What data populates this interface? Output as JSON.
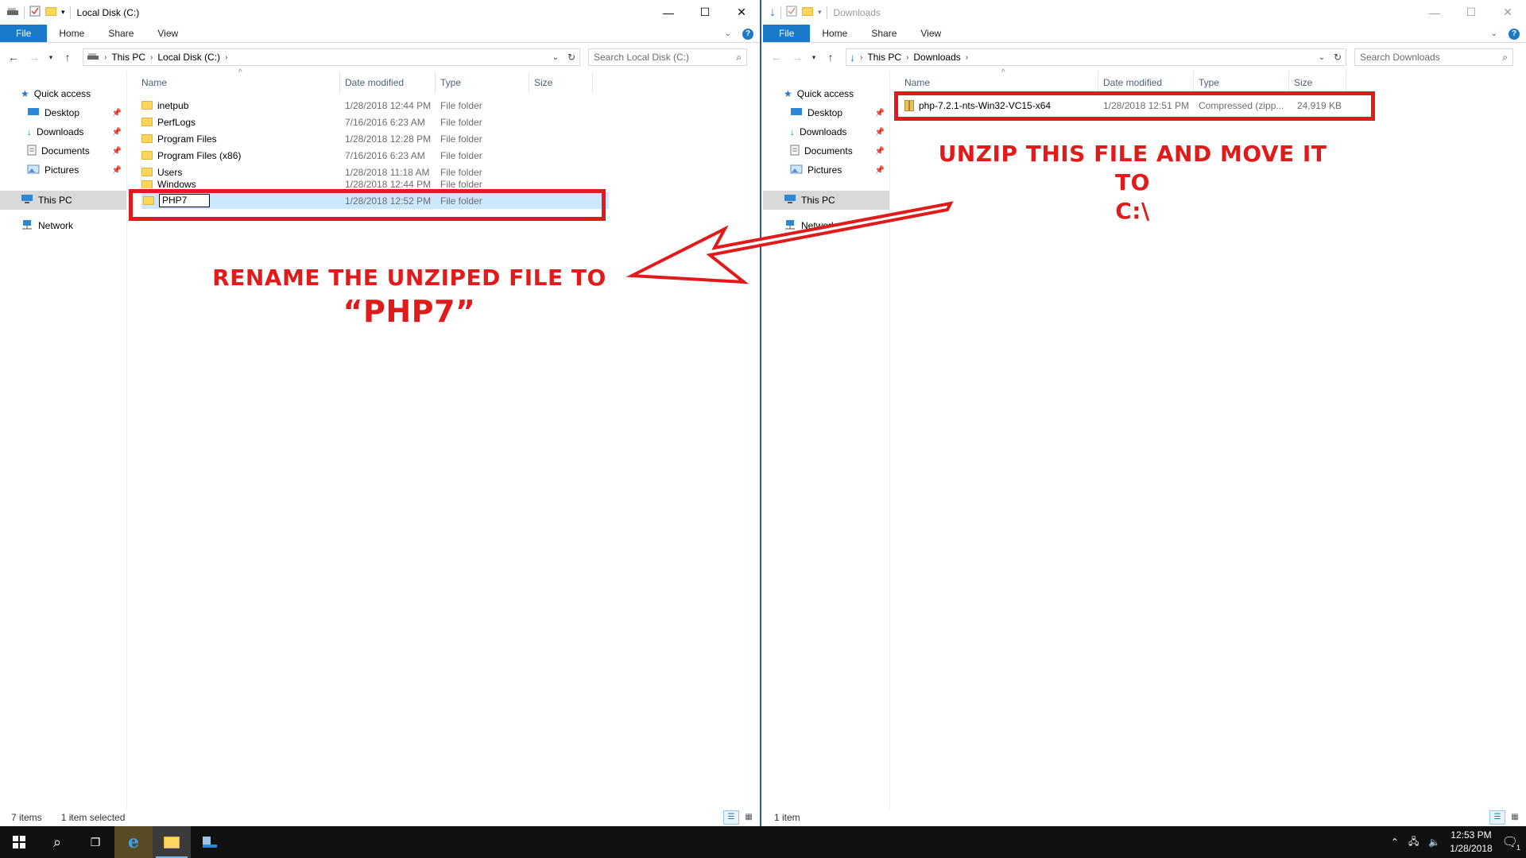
{
  "left": {
    "title": "Local Disk (C:)",
    "ribbon_tabs": [
      "File",
      "Home",
      "Share",
      "View"
    ],
    "address": [
      "This PC",
      "Local Disk (C:)"
    ],
    "search_placeholder": "Search Local Disk (C:)",
    "nav": {
      "quick_access": "Quick access",
      "items": [
        "Desktop",
        "Downloads",
        "Documents",
        "Pictures"
      ],
      "this_pc": "This PC",
      "network": "Network"
    },
    "columns": [
      "Name",
      "Date modified",
      "Type",
      "Size"
    ],
    "rows": [
      {
        "name": "inetpub",
        "date": "1/28/2018 12:44 PM",
        "type": "File folder"
      },
      {
        "name": "PerfLogs",
        "date": "7/16/2016 6:23 AM",
        "type": "File folder"
      },
      {
        "name": "Program Files",
        "date": "1/28/2018 12:28 PM",
        "type": "File folder"
      },
      {
        "name": "Program Files (x86)",
        "date": "7/16/2016 6:23 AM",
        "type": "File folder"
      },
      {
        "name": "Users",
        "date": "1/28/2018 11:18 AM",
        "type": "File folder"
      },
      {
        "name": "Windows",
        "date": "1/28/2018 12:44 PM",
        "type": "File folder"
      }
    ],
    "rename_row": {
      "name": "PHP7",
      "date": "1/28/2018 12:52 PM",
      "type": "File folder"
    },
    "status": {
      "count": "7 items",
      "selected": "1 item selected"
    }
  },
  "right": {
    "title": "Downloads",
    "ribbon_tabs": [
      "File",
      "Home",
      "Share",
      "View"
    ],
    "address": [
      "This PC",
      "Downloads"
    ],
    "search_placeholder": "Search Downloads",
    "nav": {
      "quick_access": "Quick access",
      "items": [
        "Desktop",
        "Downloads",
        "Documents",
        "Pictures"
      ],
      "this_pc": "This PC",
      "network": "Network"
    },
    "columns": [
      "Name",
      "Date modified",
      "Type",
      "Size"
    ],
    "rows": [
      {
        "name": "php-7.2.1-nts-Win32-VC15-x64",
        "date": "1/28/2018 12:51 PM",
        "type": "Compressed (zipp...",
        "size": "24,919 KB"
      }
    ],
    "status": {
      "count": "1 item"
    }
  },
  "annotations": {
    "unzip_line1": "UNZIP THIS FILE AND MOVE IT TO",
    "unzip_line2": "C:\\",
    "rename_line1": "RENAME THE UNZIPED FILE TO",
    "rename_line2": "“PHP7”"
  },
  "taskbar": {
    "time": "12:53 PM",
    "date": "1/28/2018",
    "notification_count": "1"
  },
  "colors": {
    "accent": "#1979ca",
    "annotation": "#e01b1b",
    "selection": "#cce8ff"
  }
}
